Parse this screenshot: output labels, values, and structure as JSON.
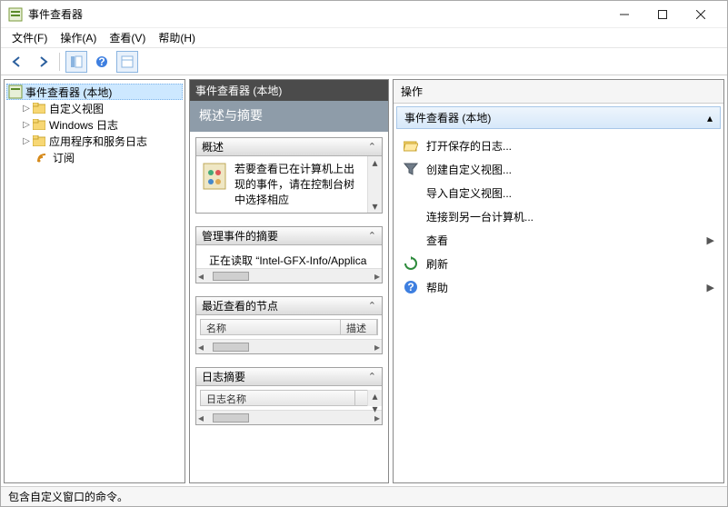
{
  "window": {
    "title": "事件查看器"
  },
  "menu": {
    "file": "文件(F)",
    "action": "操作(A)",
    "view": "查看(V)",
    "help": "帮助(H)"
  },
  "tree": {
    "root": "事件查看器 (本地)",
    "items": [
      {
        "label": "自定义视图",
        "expandable": true
      },
      {
        "label": "Windows 日志",
        "expandable": true
      },
      {
        "label": "应用程序和服务日志",
        "expandable": true
      },
      {
        "label": "订阅",
        "expandable": false
      }
    ]
  },
  "mid": {
    "header": "事件查看器 (本地)",
    "banner": "概述与摘要",
    "sections": {
      "overview": {
        "title": "概述",
        "text": "若要查看已在计算机上出现的事件，请在控制台树中选择相应"
      },
      "summary": {
        "title": "管理事件的摘要",
        "text": "正在读取 “Intel-GFX-Info/Applica"
      },
      "recent": {
        "title": "最近查看的节点",
        "col1": "名称",
        "col2": "描述"
      },
      "logsummary": {
        "title": "日志摘要",
        "col1": "日志名称"
      }
    }
  },
  "actions": {
    "header": "操作",
    "group": "事件查看器 (本地)",
    "items": [
      {
        "id": "open-saved",
        "label": "打开保存的日志...",
        "icon": "folder"
      },
      {
        "id": "create-view",
        "label": "创建自定义视图...",
        "icon": "filter"
      },
      {
        "id": "import-view",
        "label": "导入自定义视图...",
        "icon": "none",
        "indent": true
      },
      {
        "id": "connect",
        "label": "连接到另一台计算机...",
        "icon": "none",
        "indent": true
      },
      {
        "id": "view",
        "label": "查看",
        "icon": "none",
        "indent": true,
        "sub": true
      },
      {
        "id": "refresh",
        "label": "刷新",
        "icon": "refresh"
      },
      {
        "id": "help",
        "label": "帮助",
        "icon": "help",
        "sub": true
      }
    ]
  },
  "status": "包含自定义窗口的命令。"
}
